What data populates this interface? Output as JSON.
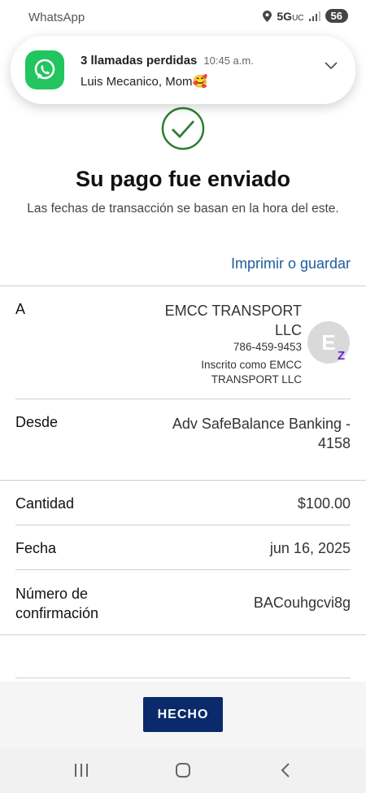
{
  "status_bar": {
    "app": "WhatsApp",
    "network": "5G",
    "network_suffix": "UC",
    "battery": "56"
  },
  "notification": {
    "title": "3 llamadas perdidas",
    "time": "10:45 a.m.",
    "body": "Luis Mecanico, Mom🥰"
  },
  "header": {
    "title": "Su pago fue enviado",
    "subtitle": "Las fechas de transacción se basan en la hora del este.",
    "print_link": "Imprimir o guardar"
  },
  "details": {
    "to": {
      "label": "A",
      "name": "EMCC TRANSPORT LLC",
      "phone": "786-459-9453",
      "enrolled": "Inscrito como EMCC TRANSPORT LLC",
      "avatar_letter": "E",
      "badge": "Z"
    },
    "from": {
      "label": "Desde",
      "value": "Adv SafeBalance Banking - 4158"
    },
    "amount": {
      "label": "Cantidad",
      "value": "$100.00"
    },
    "date": {
      "label": "Fecha",
      "value": "jun 16, 2025"
    },
    "confirmation": {
      "label": "Número de confirmación",
      "value": "BACouhgcvi8g"
    }
  },
  "footer": {
    "done_button": "HECHO"
  },
  "colors": {
    "accent": "#1f5c99",
    "button": "#0b2a6b",
    "success": "#2e7d32",
    "zelle": "#6d1ed4"
  }
}
